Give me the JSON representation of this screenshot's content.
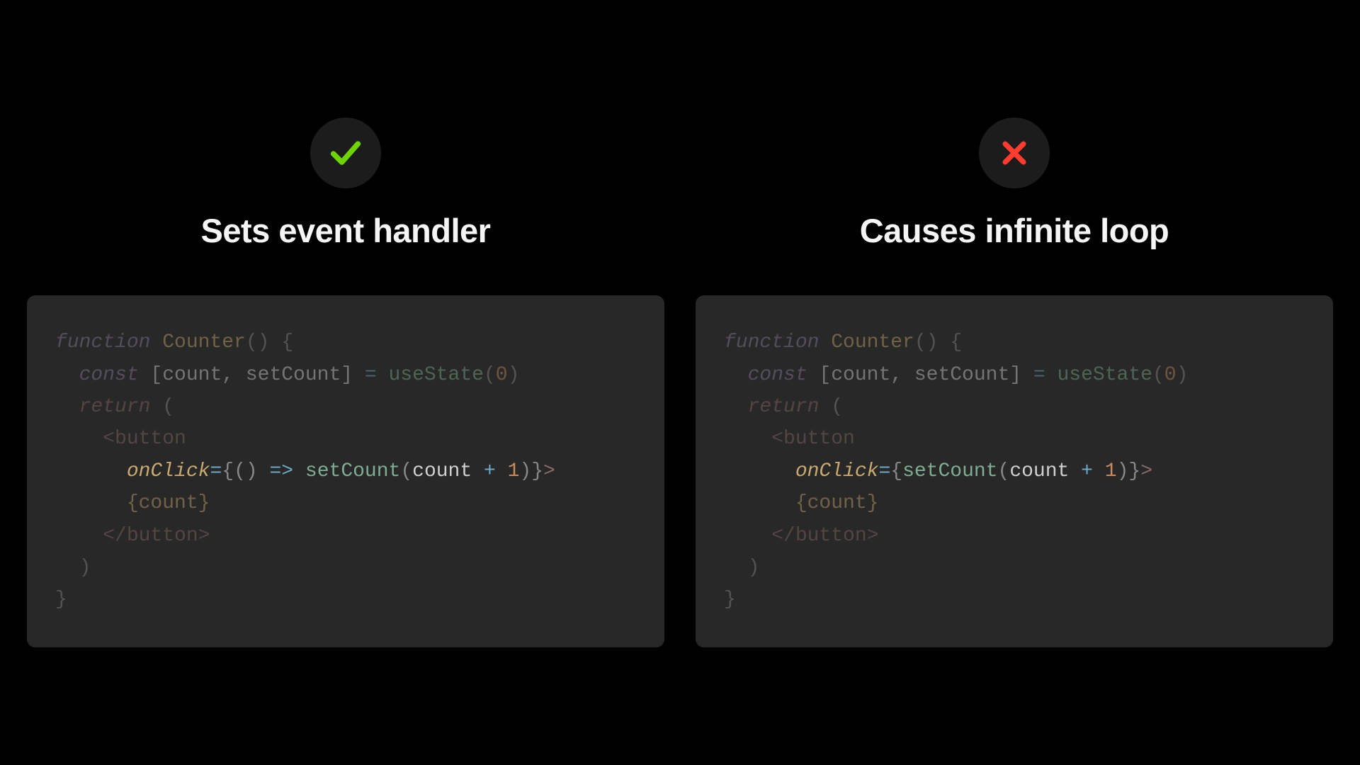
{
  "left": {
    "icon": "check-icon",
    "title": "Sets event handler",
    "code": {
      "line1_kw": "function",
      "line1_name": " Counter",
      "line1_paren": "()",
      "line1_brace": " {",
      "line2_indent": "  ",
      "line2_kw": "const",
      "line2_arr": " [count, setCount] ",
      "line2_eq": "=",
      "line2_hook": " useState",
      "line2_paren_o": "(",
      "line2_num": "0",
      "line2_paren_c": ")",
      "line3_indent": "  ",
      "line3_kw": "return",
      "line3_paren": " (",
      "line4_indent": "    ",
      "line4_tag": "<button",
      "line5_indent": "      ",
      "line5_attr": "onClick",
      "line5_eq": "=",
      "line5_brace_o": "{",
      "line5_paren": "()",
      "line5_arrow": " => ",
      "line5_fn": "setCount",
      "line5_po": "(",
      "line5_arg": "count ",
      "line5_plus": "+",
      "line5_sp": " ",
      "line5_one": "1",
      "line5_pc": ")",
      "line5_brace_c": "}",
      "line5_gt": ">",
      "line6_indent": "      ",
      "line6_expr": "{count}",
      "line7_indent": "    ",
      "line7_tag": "</button>",
      "line8_indent": "  ",
      "line8_paren": ")",
      "line9_brace": "}"
    }
  },
  "right": {
    "icon": "cross-icon",
    "title": "Causes infinite loop",
    "code": {
      "line1_kw": "function",
      "line1_name": " Counter",
      "line1_paren": "()",
      "line1_brace": " {",
      "line2_indent": "  ",
      "line2_kw": "const",
      "line2_arr": " [count, setCount] ",
      "line2_eq": "=",
      "line2_hook": " useState",
      "line2_paren_o": "(",
      "line2_num": "0",
      "line2_paren_c": ")",
      "line3_indent": "  ",
      "line3_kw": "return",
      "line3_paren": " (",
      "line4_indent": "    ",
      "line4_tag": "<button",
      "line5_indent": "      ",
      "line5_attr": "onClick",
      "line5_eq": "=",
      "line5_brace_o": "{",
      "line5_fn": "setCount",
      "line5_po": "(",
      "line5_arg": "count ",
      "line5_plus": "+",
      "line5_sp": " ",
      "line5_one": "1",
      "line5_pc": ")",
      "line5_brace_c": "}",
      "line5_gt": ">",
      "line6_indent": "      ",
      "line6_expr": "{count}",
      "line7_indent": "    ",
      "line7_tag": "</button>",
      "line8_indent": "  ",
      "line8_paren": ")",
      "line9_brace": "}"
    }
  },
  "colors": {
    "check": "#6dd400",
    "cross": "#ff3b30"
  }
}
